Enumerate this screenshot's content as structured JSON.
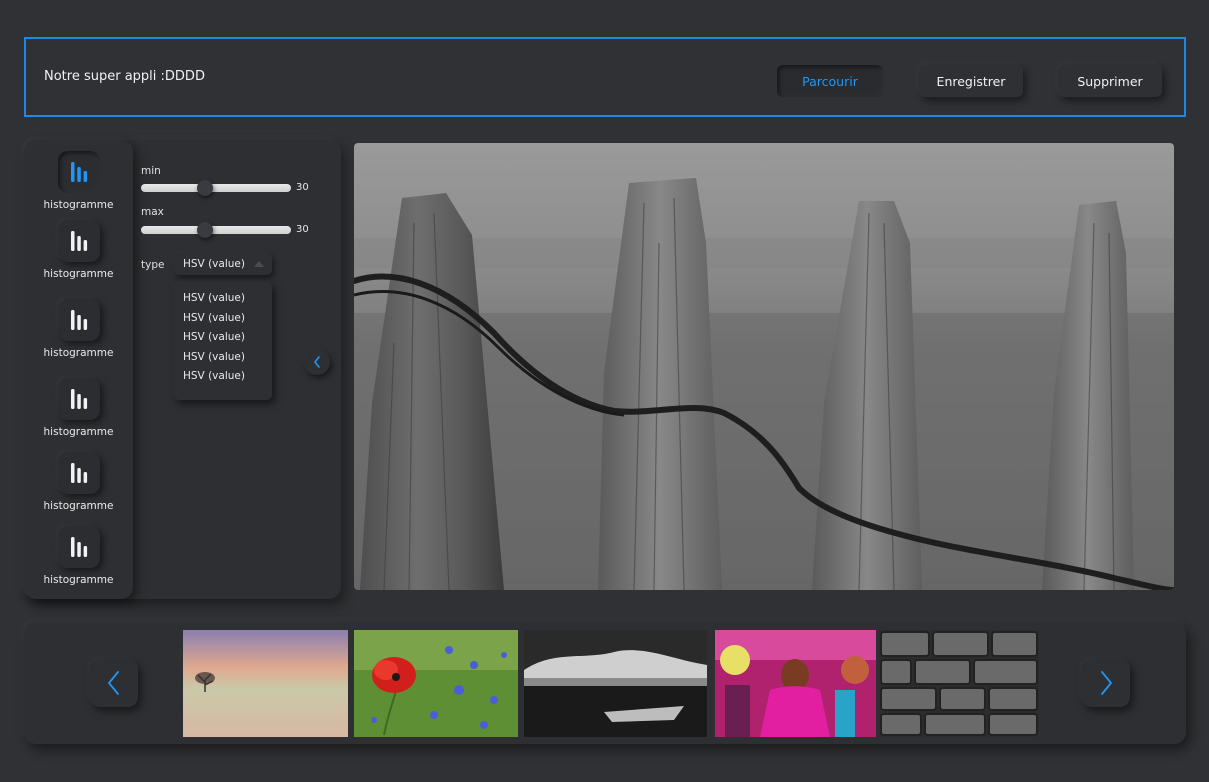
{
  "header": {
    "title": "Notre super appli :DDDD",
    "buttons": {
      "browse": "Parcourir",
      "save": "Enregistrer",
      "delete": "Supprimer"
    }
  },
  "tools": {
    "items": [
      {
        "label": "histogramme",
        "active": true
      },
      {
        "label": "histogramme",
        "active": false
      },
      {
        "label": "histogramme",
        "active": false
      },
      {
        "label": "histogramme",
        "active": false
      },
      {
        "label": "histogramme",
        "active": false
      },
      {
        "label": "histogramme",
        "active": false
      }
    ],
    "params": {
      "min_label": "min",
      "min_value": "30",
      "max_label": "max",
      "max_value": "30",
      "type_label": "type",
      "type_selected": "HSV (value)",
      "type_options": [
        "HSV (value)",
        "HSV (value)",
        "HSV (value)",
        "HSV (value)",
        "HSV (value)"
      ]
    },
    "icons": {
      "tool": "histogram-icon",
      "collapse": "chevron-left-icon"
    }
  },
  "gallery": {
    "icons": {
      "prev": "chevron-left-icon",
      "next": "chevron-right-icon"
    },
    "thumbnails": [
      "lone-tree-sunset",
      "red-poppy-field",
      "stormy-sea-boat",
      "holi-festival-dancer",
      "stone-wall"
    ]
  },
  "colors": {
    "accent": "#2196f3",
    "background": "#303134",
    "panel": "#2e2f32"
  }
}
